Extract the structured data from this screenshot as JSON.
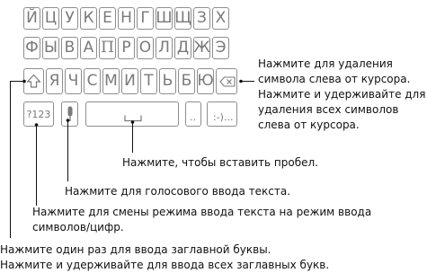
{
  "keyboard": {
    "row1": [
      "Й",
      "Ц",
      "У",
      "К",
      "Е",
      "Н",
      "Г",
      "Ш",
      "Щ",
      "З",
      "Х"
    ],
    "row2": [
      "Ф",
      "Ы",
      "В",
      "А",
      "П",
      "Р",
      "О",
      "Л",
      "Д",
      "Ж",
      "Э"
    ],
    "row3": [
      "Я",
      "Ч",
      "С",
      "М",
      "И",
      "Т",
      "Ь",
      "Б",
      "Ю"
    ],
    "row4": {
      "symbols_label": "?123",
      "dots_label": "..",
      "smiley_label": ":-)..."
    }
  },
  "icons": {
    "shift": "shift-arrow-icon",
    "backspace": "backspace-icon",
    "mic": "microphone-icon",
    "space": "space-bracket-icon"
  },
  "captions": {
    "delete": [
      "Нажмите для удаления",
      "символа слева от курсора.",
      "Нажмите и удерживайте для",
      "удаления всех символов",
      "слева от курсора."
    ],
    "space": "Нажмите, чтобы вставить пробел.",
    "voice": "Нажмите для голосового ввода текста.",
    "mode": [
      "Нажмите для смены режима ввода текста на режим ввода",
      "символов/цифр."
    ],
    "shift": [
      "Нажмите один раз для ввода заглавной буквы.",
      "Нажмите и удерживайте для ввода всех заглавных букв."
    ]
  },
  "colors": {
    "key_border": "#8e8e8e",
    "key_text": "#7a7a7a",
    "caption": "#111111"
  }
}
